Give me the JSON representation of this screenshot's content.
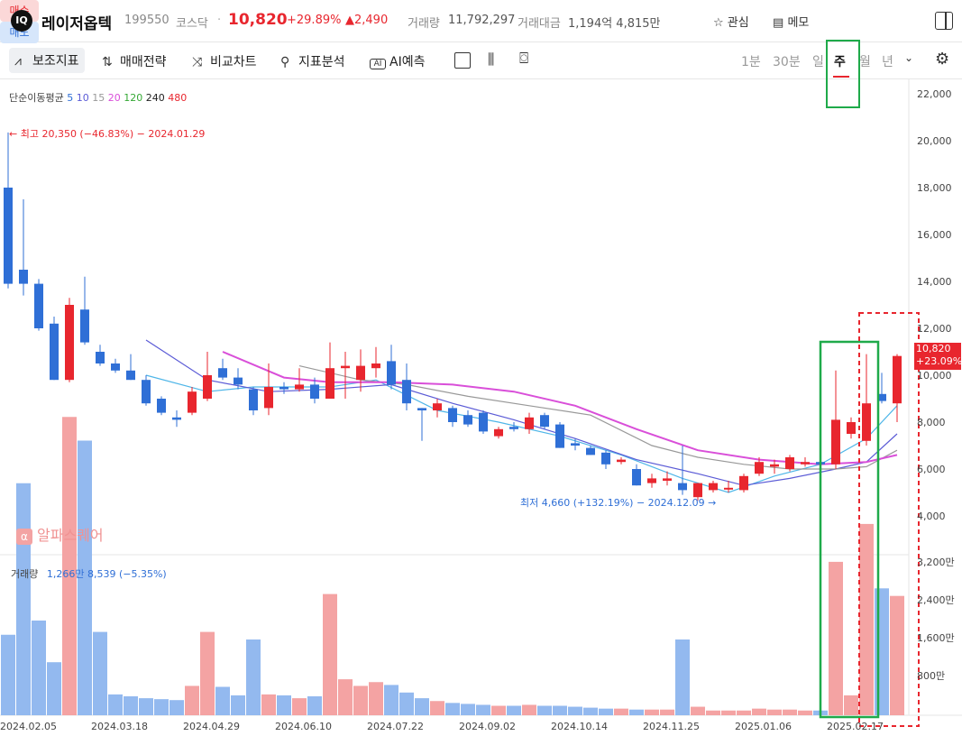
{
  "header": {
    "logo_text": "IQ",
    "name": "레이저옵텍",
    "code": "199550",
    "market": "코스닥",
    "separator": "·",
    "price": "10,820",
    "change_pct": "+29.89%",
    "change_abs": "▲2,490",
    "volume_label": "거래량",
    "volume_value": "11,792,297",
    "amount_label": "거래대금",
    "amount_value": "1,194억 4,815만",
    "watch_label": "관심",
    "memo_label": "메모",
    "buy_label": "매수",
    "sell_label": "매도"
  },
  "toolbar": {
    "indicator_label": "보조지표",
    "strategy_label": "매매전략",
    "compare_label": "비교차트",
    "analysis_label": "지표분석",
    "ai_label": "AI예측",
    "periods": [
      "1분",
      "30분",
      "일",
      "주",
      "월",
      "년"
    ]
  },
  "legend": {
    "ma_title": "단순이동평균",
    "ma_periods": [
      "5",
      "10",
      "15",
      "20",
      "120",
      "240",
      "480"
    ],
    "ma_colors": [
      "#2f6fd6",
      "#5b5bd6",
      "#999999",
      "#d94fd9",
      "#35a835",
      "#222222",
      "#e8262e"
    ],
    "high_note": "← 최고 20,350 (−46.83%) − 2024.01.29",
    "low_note": "최저 4,660 (+132.19%) − 2024.12.09 →",
    "volume_title": "거래량",
    "volume_note": "1,266만 8,539 (−5.35%)",
    "watermark": "알파스퀘어",
    "watermark_icon": "α"
  },
  "price_tag": {
    "price": "10,820",
    "pct": "+23.09%"
  },
  "colors": {
    "up": "#e8262e",
    "down": "#2f6fd6",
    "up_vol": "#f4a3a3",
    "down_vol": "#93b9ef",
    "highlight_green": "#1faa4a",
    "highlight_red": "#e8262e"
  },
  "chart_data": {
    "type": "candlestick",
    "interval": "weekly",
    "x_tick_labels": [
      "2024.02.05",
      "2024.03.18",
      "2024.04.29",
      "2024.06.10",
      "2024.07.22",
      "2024.09.02",
      "2024.10.14",
      "2024.11.25",
      "2025.01.06",
      "2025.02.17"
    ],
    "y_tick_labels": [
      "22,000",
      "20,000",
      "18,000",
      "16,000",
      "14,000",
      "12,000",
      "10,000",
      "8,000",
      "6,000",
      "4,000"
    ],
    "volume_tick_labels": [
      "3,200만",
      "2,400만",
      "1,600만",
      "800만"
    ],
    "ylim": [
      2400,
      22600
    ],
    "volume_ylim": [
      0,
      3250
    ],
    "candles": [
      {
        "o": 18000,
        "h": 20350,
        "l": 13700,
        "c": 13900
      },
      {
        "o": 14500,
        "h": 17500,
        "l": 13400,
        "c": 13900
      },
      {
        "o": 13900,
        "h": 14100,
        "l": 11900,
        "c": 12000
      },
      {
        "o": 12200,
        "h": 12500,
        "l": 9800,
        "c": 9800
      },
      {
        "o": 9800,
        "h": 13300,
        "l": 9700,
        "c": 13000
      },
      {
        "o": 12800,
        "h": 14200,
        "l": 11300,
        "c": 11400
      },
      {
        "o": 11000,
        "h": 11300,
        "l": 10400,
        "c": 10500
      },
      {
        "o": 10500,
        "h": 10700,
        "l": 10100,
        "c": 10200
      },
      {
        "o": 10200,
        "h": 10900,
        "l": 9800,
        "c": 9800
      },
      {
        "o": 9800,
        "h": 10000,
        "l": 8700,
        "c": 8800
      },
      {
        "o": 9000,
        "h": 9100,
        "l": 8300,
        "c": 8400
      },
      {
        "o": 8200,
        "h": 8500,
        "l": 7800,
        "c": 8100
      },
      {
        "o": 8400,
        "h": 9500,
        "l": 8300,
        "c": 9300
      },
      {
        "o": 9000,
        "h": 11000,
        "l": 8900,
        "c": 10000
      },
      {
        "o": 10300,
        "h": 10700,
        "l": 9800,
        "c": 9900
      },
      {
        "o": 9900,
        "h": 10300,
        "l": 9400,
        "c": 9600
      },
      {
        "o": 9400,
        "h": 9500,
        "l": 8300,
        "c": 8500
      },
      {
        "o": 8600,
        "h": 10500,
        "l": 8300,
        "c": 9500
      },
      {
        "o": 9500,
        "h": 9700,
        "l": 9200,
        "c": 9400
      },
      {
        "o": 9400,
        "h": 10300,
        "l": 9300,
        "c": 9600
      },
      {
        "o": 9600,
        "h": 9900,
        "l": 8800,
        "c": 9000
      },
      {
        "o": 9000,
        "h": 11400,
        "l": 9000,
        "c": 10300
      },
      {
        "o": 10300,
        "h": 11000,
        "l": 9000,
        "c": 10400
      },
      {
        "o": 9800,
        "h": 11100,
        "l": 9300,
        "c": 10400
      },
      {
        "o": 10300,
        "h": 11200,
        "l": 9900,
        "c": 10500
      },
      {
        "o": 10600,
        "h": 11300,
        "l": 9400,
        "c": 9600
      },
      {
        "o": 9800,
        "h": 10500,
        "l": 8500,
        "c": 8800
      },
      {
        "o": 8600,
        "h": 8600,
        "l": 7200,
        "c": 8500
      },
      {
        "o": 8500,
        "h": 9000,
        "l": 8200,
        "c": 8800
      },
      {
        "o": 8600,
        "h": 8700,
        "l": 7800,
        "c": 8000
      },
      {
        "o": 8300,
        "h": 8500,
        "l": 7800,
        "c": 7900
      },
      {
        "o": 8400,
        "h": 8500,
        "l": 7500,
        "c": 7600
      },
      {
        "o": 7400,
        "h": 7800,
        "l": 7300,
        "c": 7700
      },
      {
        "o": 7800,
        "h": 8000,
        "l": 7600,
        "c": 7700
      },
      {
        "o": 7700,
        "h": 8400,
        "l": 7500,
        "c": 8200
      },
      {
        "o": 8300,
        "h": 8400,
        "l": 7700,
        "c": 7800
      },
      {
        "o": 7900,
        "h": 8000,
        "l": 6900,
        "c": 6900
      },
      {
        "o": 7100,
        "h": 7300,
        "l": 6800,
        "c": 7000
      },
      {
        "o": 6900,
        "h": 7000,
        "l": 6600,
        "c": 6600
      },
      {
        "o": 6700,
        "h": 6800,
        "l": 6000,
        "c": 6200
      },
      {
        "o": 6300,
        "h": 6500,
        "l": 6200,
        "c": 6400
      },
      {
        "o": 6000,
        "h": 6200,
        "l": 5300,
        "c": 5300
      },
      {
        "o": 5400,
        "h": 5800,
        "l": 5200,
        "c": 5600
      },
      {
        "o": 5500,
        "h": 5900,
        "l": 5300,
        "c": 5600
      },
      {
        "o": 5400,
        "h": 7000,
        "l": 4900,
        "c": 5100
      },
      {
        "o": 4800,
        "h": 5400,
        "l": 4660,
        "c": 5400
      },
      {
        "o": 5100,
        "h": 5500,
        "l": 5000,
        "c": 5400
      },
      {
        "o": 5200,
        "h": 5500,
        "l": 5000,
        "c": 5200
      },
      {
        "o": 5100,
        "h": 5800,
        "l": 5000,
        "c": 5700
      },
      {
        "o": 5800,
        "h": 6500,
        "l": 5700,
        "c": 6300
      },
      {
        "o": 6100,
        "h": 6400,
        "l": 5800,
        "c": 6200
      },
      {
        "o": 6000,
        "h": 6600,
        "l": 5900,
        "c": 6500
      },
      {
        "o": 6200,
        "h": 6500,
        "l": 6100,
        "c": 6300
      },
      {
        "o": 6300,
        "h": 6400,
        "l": 6000,
        "c": 6200
      },
      {
        "o": 6200,
        "h": 10200,
        "l": 6000,
        "c": 8100
      },
      {
        "o": 7500,
        "h": 8200,
        "l": 7300,
        "c": 8000
      },
      {
        "o": 7200,
        "h": 10900,
        "l": 7000,
        "c": 8800
      },
      {
        "o": 9200,
        "h": 10100,
        "l": 8800,
        "c": 8900
      },
      {
        "o": 8800,
        "h": 10900,
        "l": 8000,
        "c": 10820
      }
    ],
    "volumes": [
      850,
      2450,
      1000,
      560,
      3150,
      2900,
      880,
      220,
      200,
      180,
      170,
      160,
      310,
      880,
      300,
      210,
      800,
      220,
      210,
      180,
      200,
      1280,
      380,
      310,
      350,
      320,
      240,
      180,
      150,
      130,
      120,
      110,
      100,
      100,
      110,
      100,
      100,
      90,
      80,
      70,
      70,
      60,
      60,
      60,
      800,
      90,
      50,
      50,
      50,
      70,
      60,
      60,
      50,
      50,
      1620,
      210,
      2020,
      1340,
      1260
    ],
    "ma": {
      "5": [
        [
          9,
          10000
        ],
        [
          13,
          9300
        ],
        [
          16,
          9500
        ],
        [
          21,
          9500
        ],
        [
          24,
          9800
        ],
        [
          28,
          8500
        ],
        [
          32,
          8000
        ],
        [
          36,
          7400
        ],
        [
          40,
          6600
        ],
        [
          44,
          5600
        ],
        [
          47,
          5000
        ],
        [
          50,
          5700
        ],
        [
          53,
          6200
        ],
        [
          56,
          7300
        ],
        [
          58,
          8700
        ]
      ],
      "10": [
        [
          9,
          11500
        ],
        [
          13,
          9800
        ],
        [
          17,
          9300
        ],
        [
          21,
          9400
        ],
        [
          25,
          9600
        ],
        [
          29,
          8800
        ],
        [
          33,
          8100
        ],
        [
          37,
          7300
        ],
        [
          41,
          6400
        ],
        [
          45,
          5800
        ],
        [
          48,
          5300
        ],
        [
          51,
          5600
        ],
        [
          54,
          6000
        ],
        [
          56,
          6300
        ],
        [
          58,
          7500
        ]
      ],
      "20": [
        [
          19,
          10400
        ],
        [
          23,
          9800
        ],
        [
          26,
          9600
        ],
        [
          30,
          9100
        ],
        [
          34,
          8700
        ],
        [
          38,
          8300
        ],
        [
          42,
          7000
        ],
        [
          45,
          6500
        ],
        [
          48,
          6200
        ],
        [
          51,
          6000
        ],
        [
          54,
          6000
        ],
        [
          56,
          6100
        ],
        [
          58,
          6800
        ]
      ],
      "120": [
        [
          14,
          11000
        ],
        [
          18,
          9900
        ],
        [
          21,
          9700
        ],
        [
          25,
          9700
        ],
        [
          29,
          9600
        ],
        [
          33,
          9300
        ],
        [
          37,
          8700
        ],
        [
          41,
          7700
        ],
        [
          45,
          6800
        ],
        [
          49,
          6400
        ],
        [
          53,
          6200
        ],
        [
          56,
          6300
        ],
        [
          58,
          6600
        ]
      ]
    }
  }
}
